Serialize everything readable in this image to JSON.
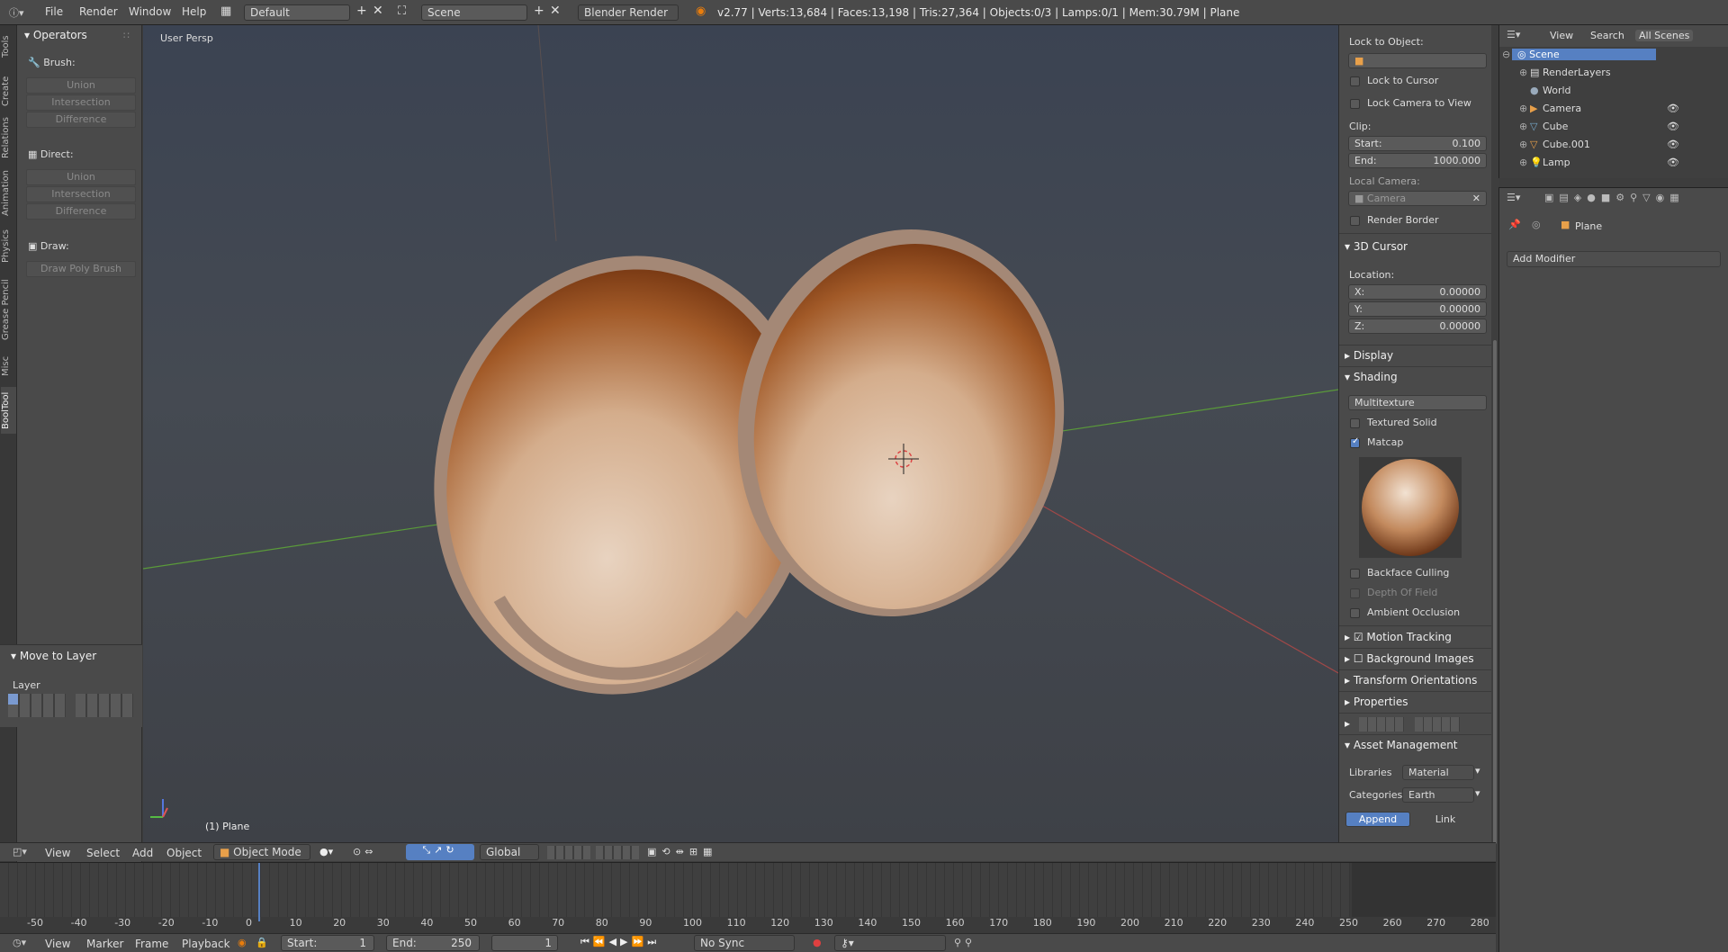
{
  "topbar": {
    "menus": [
      "File",
      "Render",
      "Window",
      "Help"
    ],
    "layout": "Default",
    "scene": "Scene",
    "engine": "Blender Render",
    "stats": "v2.77 | Verts:13,684 | Faces:13,198 | Tris:27,364 | Objects:0/3 | Lamps:0/1 | Mem:30.79M | Plane"
  },
  "left_tabs": [
    "Tools",
    "Create",
    "Relations",
    "Animation",
    "Physics",
    "Grease Pencil",
    "Misc",
    "BoolTool"
  ],
  "toolshelf": {
    "operators_title": "Operators",
    "brush_label": "Brush:",
    "brush_buttons": [
      "Union",
      "Intersection",
      "Difference"
    ],
    "direct_label": "Direct:",
    "direct_buttons": [
      "Union",
      "Intersection",
      "Difference"
    ],
    "draw_label": "Draw:",
    "draw_button": "Draw Poly Brush",
    "move_to_layer": "Move to Layer",
    "layer_label": "Layer"
  },
  "viewport": {
    "view_label": "User Persp",
    "object_label": "(1) Plane"
  },
  "npanel": {
    "lock_to_object": "Lock to Object:",
    "lock_to_cursor": "Lock to Cursor",
    "lock_camera": "Lock Camera to View",
    "clip": "Clip:",
    "clip_start_label": "Start:",
    "clip_start": "0.100",
    "clip_end_label": "End:",
    "clip_end": "1000.000",
    "local_camera": "Local Camera:",
    "local_camera_value": "Camera",
    "render_border": "Render Border",
    "cursor_title": "3D Cursor",
    "location": "Location:",
    "x_label": "X:",
    "x": "0.00000",
    "y_label": "Y:",
    "y": "0.00000",
    "z_label": "Z:",
    "z": "0.00000",
    "display": "Display",
    "shading": "Shading",
    "shading_mode": "Multitexture",
    "textured_solid": "Textured Solid",
    "matcap": "Matcap",
    "backface": "Backface Culling",
    "dof": "Depth Of Field",
    "ao": "Ambient Occlusion",
    "motion_tracking": "Motion Tracking",
    "bg_images": "Background Images",
    "transform_orient": "Transform Orientations",
    "properties": "Properties",
    "asset_mgmt": "Asset Management",
    "libraries_label": "Libraries",
    "libraries_value": "Material",
    "categories_label": "Categories",
    "categories_value": "Earth",
    "append": "Append",
    "link": "Link"
  },
  "outliner": {
    "tabs": [
      "View",
      "Search",
      "All Scenes"
    ],
    "items": [
      "Scene",
      "RenderLayers",
      "World",
      "Camera",
      "Cube",
      "Cube.001",
      "Lamp"
    ]
  },
  "props": {
    "object_name": "Plane",
    "add_modifier": "Add Modifier"
  },
  "view_header": {
    "menus": [
      "View",
      "Select",
      "Add",
      "Object"
    ],
    "mode": "Object Mode",
    "orientation": "Global"
  },
  "timeline": {
    "ticks": [
      "-50",
      "-40",
      "-30",
      "-20",
      "-10",
      "0",
      "10",
      "20",
      "30",
      "40",
      "50",
      "60",
      "70",
      "80",
      "90",
      "100",
      "110",
      "120",
      "130",
      "140",
      "150",
      "160",
      "170",
      "180",
      "190",
      "200",
      "210",
      "220",
      "230",
      "240",
      "250",
      "260",
      "270",
      "280"
    ],
    "menus": [
      "View",
      "Marker",
      "Frame",
      "Playback"
    ],
    "start_label": "Start:",
    "start": "1",
    "end_label": "End:",
    "end": "250",
    "current": "1",
    "sync": "No Sync"
  }
}
